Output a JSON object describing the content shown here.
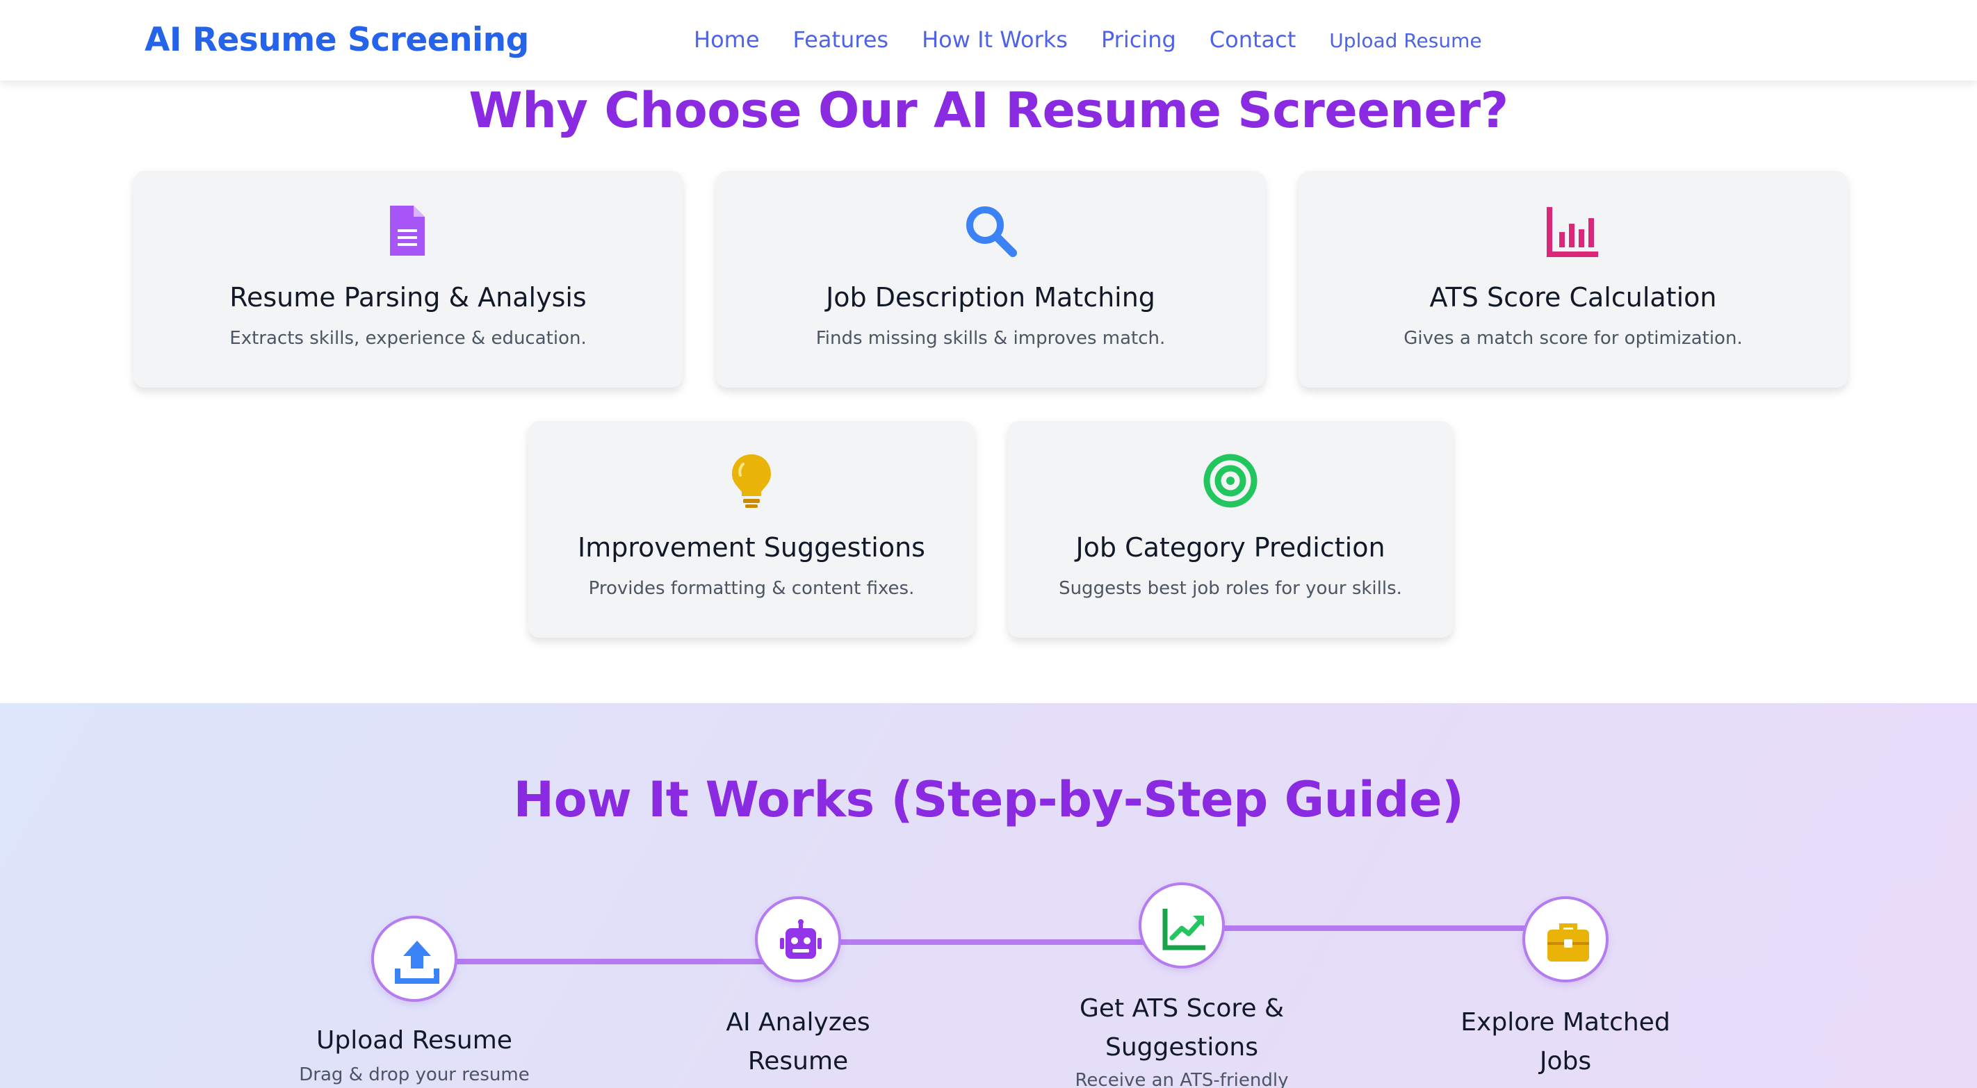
{
  "brand": "AI Resume Screening",
  "nav": {
    "home": "Home",
    "features": "Features",
    "how_it_works": "How It Works",
    "pricing": "Pricing",
    "contact": "Contact",
    "upload": "Upload Resume"
  },
  "features": {
    "title": "Why Choose Our AI Resume Screener?",
    "cards": [
      {
        "icon": "document-icon",
        "title": "Resume Parsing & Analysis",
        "desc": "Extracts skills, experience & education."
      },
      {
        "icon": "magnifier-icon",
        "title": "Job Description Matching",
        "desc": "Finds missing skills & improves match."
      },
      {
        "icon": "bar-chart-icon",
        "title": "ATS Score Calculation",
        "desc": "Gives a match score for optimization."
      },
      {
        "icon": "lightbulb-icon",
        "title": "Improvement Suggestions",
        "desc": "Provides formatting & content fixes."
      },
      {
        "icon": "target-icon",
        "title": "Job Category Prediction",
        "desc": "Suggests best job roles for your skills."
      }
    ]
  },
  "how": {
    "title": "How It Works (Step-by-Step Guide)",
    "steps": [
      {
        "icon": "upload-icon",
        "title_line1": "Upload Resume",
        "title_line2": "",
        "desc": "Drag & drop your resume"
      },
      {
        "icon": "robot-icon",
        "title_line1": "AI Analyzes",
        "title_line2": "Resume",
        "desc": ""
      },
      {
        "icon": "chart-trend-icon",
        "title_line1": "Get ATS Score &",
        "title_line2": "Suggestions",
        "desc": "Receive an ATS-friendly"
      },
      {
        "icon": "briefcase-icon",
        "title_line1": "Explore Matched",
        "title_line2": "Jobs",
        "desc": ""
      }
    ]
  },
  "colors": {
    "brand_blue": "#2563eb",
    "nav_link": "#4f63e8",
    "heading_purple": "#8a2be2",
    "card_bg": "#f3f4f6",
    "timeline_purple": "#b57bf0",
    "icon_doc_purple": "#a855f7",
    "icon_search_blue": "#3b82f6",
    "icon_chart_pink": "#db2777",
    "icon_bulb_yellow": "#eab308",
    "icon_target_green": "#22c55e"
  }
}
